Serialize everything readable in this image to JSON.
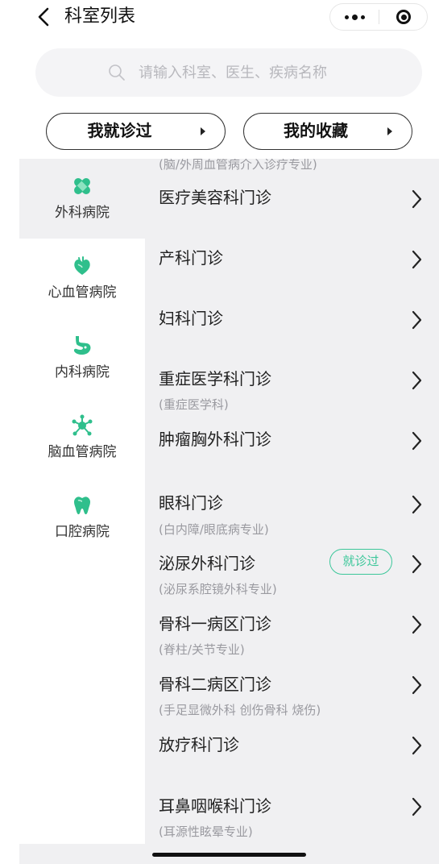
{
  "nav": {
    "title": "科室列表",
    "back_icon": "chevron-left-icon",
    "more_icon": "more-dots-icon",
    "close_icon": "target-circle-icon"
  },
  "search": {
    "placeholder": "请输入科室、医生、疾病名称",
    "value": ""
  },
  "pills": [
    {
      "label": "我就诊过"
    },
    {
      "label": "我的收藏"
    }
  ],
  "sidebar": {
    "items": [
      {
        "label": "外科病院",
        "icon": "bandage-icon",
        "active": true
      },
      {
        "label": "心血管病院",
        "icon": "heart-icon",
        "active": false
      },
      {
        "label": "内科病院",
        "icon": "stomach-icon",
        "active": false
      },
      {
        "label": "脑血管病院",
        "icon": "neuron-icon",
        "active": false
      },
      {
        "label": "口腔病院",
        "icon": "tooth-icon",
        "active": false
      }
    ]
  },
  "list": {
    "cut_top_sub": "(脑/外周血管病介入诊疗专业)",
    "items": [
      {
        "name": "医疗美容科门诊",
        "sub": ""
      },
      {
        "name": "产科门诊",
        "sub": ""
      },
      {
        "name": "妇科门诊",
        "sub": ""
      },
      {
        "name": "重症医学科门诊",
        "sub": "(重症医学科)"
      },
      {
        "name": "肿瘤胸外科门诊",
        "sub": ""
      },
      {
        "name": "眼科门诊",
        "sub": "(白内障/眼底病专业)"
      },
      {
        "name": "泌尿外科门诊",
        "sub": "(泌尿系腔镜外科专业)",
        "badge": "就诊过"
      },
      {
        "name": "骨科一病区门诊",
        "sub": "(脊柱/关节专业)"
      },
      {
        "name": "骨科二病区门诊",
        "sub": "(手足显微外科 创伤骨科 烧伤)"
      },
      {
        "name": "放疗科门诊",
        "sub": ""
      },
      {
        "name": "耳鼻咽喉科门诊",
        "sub": "(耳源性眩晕专业)"
      }
    ]
  },
  "colors": {
    "accent": "#3cc79a",
    "list_bg": "#f0f0f2",
    "text": "#222222",
    "sub_text": "#9a9aa0"
  }
}
